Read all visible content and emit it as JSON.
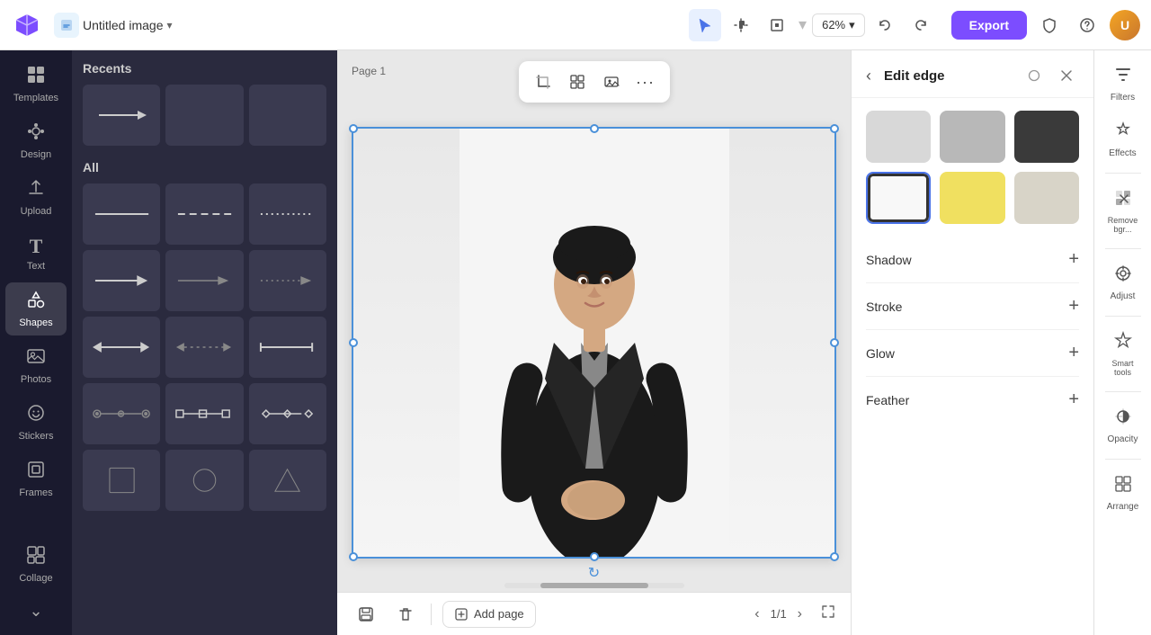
{
  "topbar": {
    "title": "Untitled image",
    "zoom": "62%",
    "export_label": "Export",
    "undo_label": "Undo",
    "redo_label": "Redo"
  },
  "sidebar": {
    "items": [
      {
        "id": "templates",
        "label": "Templates",
        "icon": "⊞"
      },
      {
        "id": "design",
        "label": "Design",
        "icon": "✦"
      },
      {
        "id": "upload",
        "label": "Upload",
        "icon": "⬆"
      },
      {
        "id": "text",
        "label": "Text",
        "icon": "T"
      },
      {
        "id": "shapes",
        "label": "Shapes",
        "icon": "◇"
      },
      {
        "id": "photos",
        "label": "Photos",
        "icon": "🖼"
      },
      {
        "id": "stickers",
        "label": "Stickers",
        "icon": "😊"
      },
      {
        "id": "frames",
        "label": "Frames",
        "icon": "▣"
      },
      {
        "id": "collage",
        "label": "Collage",
        "icon": "⊞"
      }
    ]
  },
  "shapes_panel": {
    "recents_title": "Recents",
    "all_title": "All"
  },
  "canvas": {
    "page_label": "Page 1",
    "add_page_label": "Add page",
    "page_current": "1",
    "page_total": "1"
  },
  "edit_edge_panel": {
    "title": "Edit edge",
    "back_label": "‹",
    "swatches": [
      {
        "id": "light-gray",
        "bg": "#d0d0d0",
        "border": "#d0d0d0"
      },
      {
        "id": "mid-gray",
        "bg": "#b0b0b0",
        "border": "#b0b0b0"
      },
      {
        "id": "dark-gray",
        "bg": "#404040",
        "border": "#404040"
      },
      {
        "id": "white-border",
        "bg": "#ffffff",
        "border": "#333",
        "has_border": true
      },
      {
        "id": "yellow",
        "bg": "#f0d060",
        "border": "#f0d060"
      },
      {
        "id": "light-gray2",
        "bg": "#d8d8d0",
        "border": "#d8d8d0"
      }
    ],
    "options": [
      {
        "id": "shadow",
        "label": "Shadow"
      },
      {
        "id": "stroke",
        "label": "Stroke"
      },
      {
        "id": "glow",
        "label": "Glow"
      },
      {
        "id": "feather",
        "label": "Feather"
      }
    ]
  },
  "right_icons": [
    {
      "id": "filters",
      "label": "Filters",
      "icon": "⊞"
    },
    {
      "id": "effects",
      "label": "Effects",
      "icon": "✦"
    },
    {
      "id": "remove-bg",
      "label": "Remove\nbgr...",
      "icon": "✂"
    },
    {
      "id": "adjust",
      "label": "Adjust",
      "icon": "⊙"
    },
    {
      "id": "smart-tools",
      "label": "Smart\ntools",
      "icon": "✧"
    },
    {
      "id": "opacity",
      "label": "Opacity",
      "icon": "◎"
    },
    {
      "id": "arrange",
      "label": "Arrange",
      "icon": "⊞"
    }
  ]
}
